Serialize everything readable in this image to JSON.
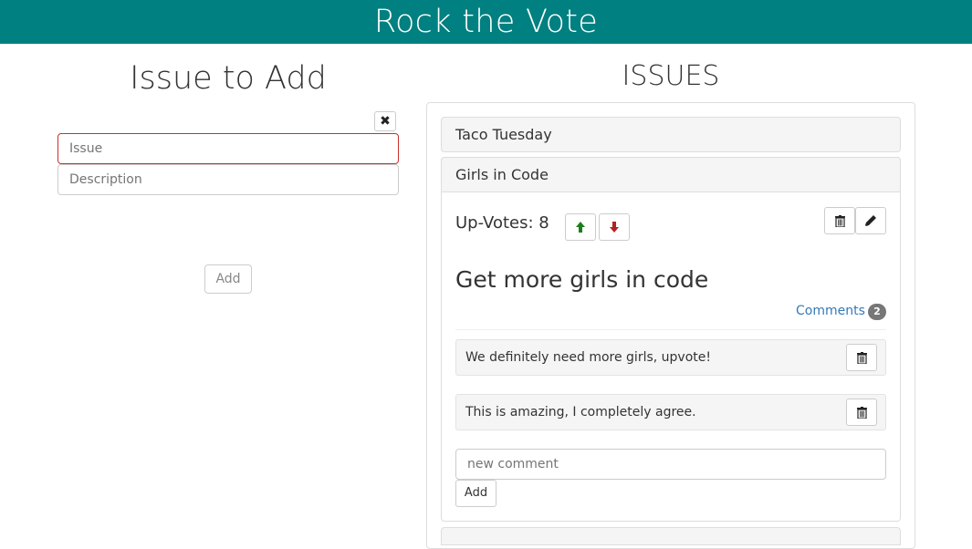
{
  "header": {
    "title": "Rock the Vote",
    "bg_color": "#008080"
  },
  "add_form": {
    "title": "Issue to Add",
    "close_icon": "close-x-icon",
    "issue_placeholder": "Issue",
    "issue_value": "",
    "description_placeholder": "Description",
    "description_value": "",
    "add_label": "Add"
  },
  "issues": {
    "title": "ISSUES",
    "list": [
      {
        "title": "Taco Tuesday",
        "expanded": false
      },
      {
        "title": "Girls in Code",
        "expanded": true,
        "upvotes_label": "Up-Votes: 8",
        "upvotes": 8,
        "upvote_icon": "arrow-up-icon",
        "downvote_icon": "arrow-down-icon",
        "delete_icon": "trash-icon",
        "edit_icon": "pencil-icon",
        "description": "Get more girls in code",
        "comments_label": "Comments",
        "comments_count": "2",
        "comments": [
          {
            "text": "We definitely need more girls, upvote!"
          },
          {
            "text": "This is amazing, I completely agree."
          }
        ],
        "new_comment_placeholder": "new comment",
        "add_comment_label": "Add"
      }
    ]
  },
  "colors": {
    "upvote": "#1a7f1a",
    "downvote": "#b52020",
    "link": "#337ab7",
    "error_border": "#c9302c"
  }
}
